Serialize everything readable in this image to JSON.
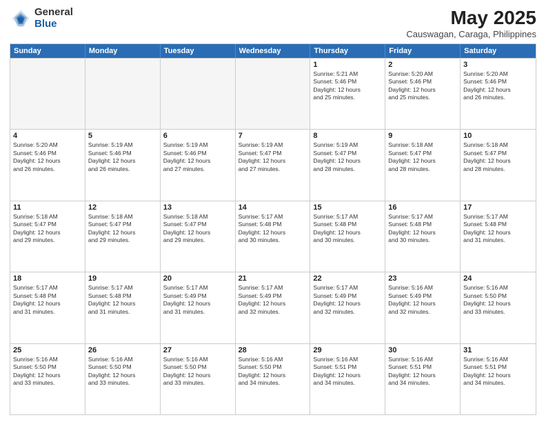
{
  "header": {
    "logo_general": "General",
    "logo_blue": "Blue",
    "title": "May 2025",
    "subtitle": "Causwagan, Caraga, Philippines"
  },
  "calendar": {
    "days_of_week": [
      "Sunday",
      "Monday",
      "Tuesday",
      "Wednesday",
      "Thursday",
      "Friday",
      "Saturday"
    ],
    "rows": [
      [
        {
          "day": "",
          "info": "",
          "empty": true
        },
        {
          "day": "",
          "info": "",
          "empty": true
        },
        {
          "day": "",
          "info": "",
          "empty": true
        },
        {
          "day": "",
          "info": "",
          "empty": true
        },
        {
          "day": "1",
          "info": "Sunrise: 5:21 AM\nSunset: 5:46 PM\nDaylight: 12 hours\nand 25 minutes."
        },
        {
          "day": "2",
          "info": "Sunrise: 5:20 AM\nSunset: 5:46 PM\nDaylight: 12 hours\nand 25 minutes."
        },
        {
          "day": "3",
          "info": "Sunrise: 5:20 AM\nSunset: 5:46 PM\nDaylight: 12 hours\nand 26 minutes."
        }
      ],
      [
        {
          "day": "4",
          "info": "Sunrise: 5:20 AM\nSunset: 5:46 PM\nDaylight: 12 hours\nand 26 minutes."
        },
        {
          "day": "5",
          "info": "Sunrise: 5:19 AM\nSunset: 5:46 PM\nDaylight: 12 hours\nand 26 minutes."
        },
        {
          "day": "6",
          "info": "Sunrise: 5:19 AM\nSunset: 5:46 PM\nDaylight: 12 hours\nand 27 minutes."
        },
        {
          "day": "7",
          "info": "Sunrise: 5:19 AM\nSunset: 5:47 PM\nDaylight: 12 hours\nand 27 minutes."
        },
        {
          "day": "8",
          "info": "Sunrise: 5:19 AM\nSunset: 5:47 PM\nDaylight: 12 hours\nand 28 minutes."
        },
        {
          "day": "9",
          "info": "Sunrise: 5:18 AM\nSunset: 5:47 PM\nDaylight: 12 hours\nand 28 minutes."
        },
        {
          "day": "10",
          "info": "Sunrise: 5:18 AM\nSunset: 5:47 PM\nDaylight: 12 hours\nand 28 minutes."
        }
      ],
      [
        {
          "day": "11",
          "info": "Sunrise: 5:18 AM\nSunset: 5:47 PM\nDaylight: 12 hours\nand 29 minutes."
        },
        {
          "day": "12",
          "info": "Sunrise: 5:18 AM\nSunset: 5:47 PM\nDaylight: 12 hours\nand 29 minutes."
        },
        {
          "day": "13",
          "info": "Sunrise: 5:18 AM\nSunset: 5:47 PM\nDaylight: 12 hours\nand 29 minutes."
        },
        {
          "day": "14",
          "info": "Sunrise: 5:17 AM\nSunset: 5:48 PM\nDaylight: 12 hours\nand 30 minutes."
        },
        {
          "day": "15",
          "info": "Sunrise: 5:17 AM\nSunset: 5:48 PM\nDaylight: 12 hours\nand 30 minutes."
        },
        {
          "day": "16",
          "info": "Sunrise: 5:17 AM\nSunset: 5:48 PM\nDaylight: 12 hours\nand 30 minutes."
        },
        {
          "day": "17",
          "info": "Sunrise: 5:17 AM\nSunset: 5:48 PM\nDaylight: 12 hours\nand 31 minutes."
        }
      ],
      [
        {
          "day": "18",
          "info": "Sunrise: 5:17 AM\nSunset: 5:48 PM\nDaylight: 12 hours\nand 31 minutes."
        },
        {
          "day": "19",
          "info": "Sunrise: 5:17 AM\nSunset: 5:48 PM\nDaylight: 12 hours\nand 31 minutes."
        },
        {
          "day": "20",
          "info": "Sunrise: 5:17 AM\nSunset: 5:49 PM\nDaylight: 12 hours\nand 31 minutes."
        },
        {
          "day": "21",
          "info": "Sunrise: 5:17 AM\nSunset: 5:49 PM\nDaylight: 12 hours\nand 32 minutes."
        },
        {
          "day": "22",
          "info": "Sunrise: 5:17 AM\nSunset: 5:49 PM\nDaylight: 12 hours\nand 32 minutes."
        },
        {
          "day": "23",
          "info": "Sunrise: 5:16 AM\nSunset: 5:49 PM\nDaylight: 12 hours\nand 32 minutes."
        },
        {
          "day": "24",
          "info": "Sunrise: 5:16 AM\nSunset: 5:50 PM\nDaylight: 12 hours\nand 33 minutes."
        }
      ],
      [
        {
          "day": "25",
          "info": "Sunrise: 5:16 AM\nSunset: 5:50 PM\nDaylight: 12 hours\nand 33 minutes."
        },
        {
          "day": "26",
          "info": "Sunrise: 5:16 AM\nSunset: 5:50 PM\nDaylight: 12 hours\nand 33 minutes."
        },
        {
          "day": "27",
          "info": "Sunrise: 5:16 AM\nSunset: 5:50 PM\nDaylight: 12 hours\nand 33 minutes."
        },
        {
          "day": "28",
          "info": "Sunrise: 5:16 AM\nSunset: 5:50 PM\nDaylight: 12 hours\nand 34 minutes."
        },
        {
          "day": "29",
          "info": "Sunrise: 5:16 AM\nSunset: 5:51 PM\nDaylight: 12 hours\nand 34 minutes."
        },
        {
          "day": "30",
          "info": "Sunrise: 5:16 AM\nSunset: 5:51 PM\nDaylight: 12 hours\nand 34 minutes."
        },
        {
          "day": "31",
          "info": "Sunrise: 5:16 AM\nSunset: 5:51 PM\nDaylight: 12 hours\nand 34 minutes."
        }
      ]
    ]
  }
}
